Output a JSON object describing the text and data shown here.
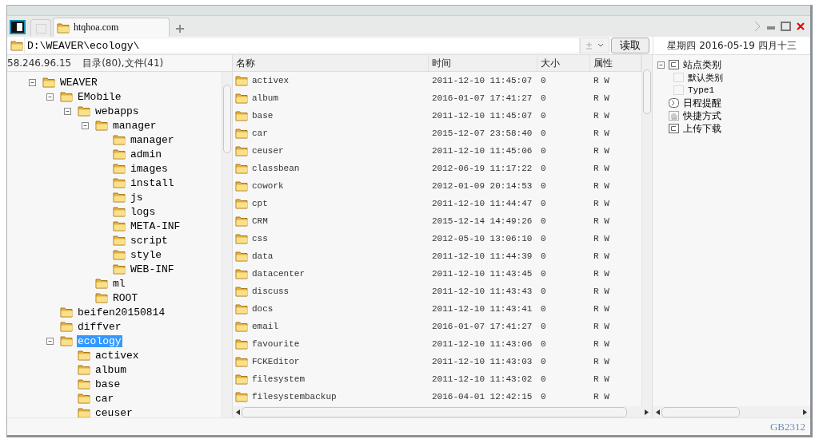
{
  "tabs": [
    {
      "kind": "panel",
      "selected": true
    },
    {
      "kind": "blank",
      "selected": false
    },
    {
      "kind": "site",
      "label": "htqhoa.com",
      "selected": true
    }
  ],
  "address": {
    "value": "D:\\WEAVER\\ecology\\",
    "button": "读取"
  },
  "date": "星期四 2016-05-19 四月十三",
  "server": {
    "ip": "58.246.96.15",
    "counts": "目录(80),文件(41)"
  },
  "folder_tree": [
    {
      "name": "WEAVER",
      "expanded": true,
      "selected": false,
      "children": [
        {
          "name": "EMobile",
          "expanded": true,
          "selected": false,
          "children": [
            {
              "name": "webapps",
              "expanded": true,
              "selected": false,
              "children": [
                {
                  "name": "manager",
                  "expanded": true,
                  "selected": false,
                  "children": [
                    {
                      "name": "manager",
                      "selected": false
                    },
                    {
                      "name": "admin",
                      "selected": false
                    },
                    {
                      "name": "images",
                      "selected": false
                    },
                    {
                      "name": "install",
                      "selected": false
                    },
                    {
                      "name": "js",
                      "selected": false
                    },
                    {
                      "name": "logs",
                      "selected": false
                    },
                    {
                      "name": "META-INF",
                      "selected": false
                    },
                    {
                      "name": "script",
                      "selected": false
                    },
                    {
                      "name": "style",
                      "selected": false
                    },
                    {
                      "name": "WEB-INF",
                      "selected": false
                    }
                  ]
                },
                {
                  "name": "ml",
                  "selected": false
                },
                {
                  "name": "ROOT",
                  "selected": false
                }
              ]
            }
          ]
        },
        {
          "name": "beifen20150814",
          "selected": false
        },
        {
          "name": "diffver",
          "selected": false
        },
        {
          "name": "ecology",
          "expanded": true,
          "selected": true,
          "children": [
            {
              "name": "activex",
              "selected": false
            },
            {
              "name": "album",
              "selected": false
            },
            {
              "name": "base",
              "selected": false
            },
            {
              "name": "car",
              "selected": false
            },
            {
              "name": "ceuser",
              "selected": false
            }
          ]
        }
      ]
    }
  ],
  "table": {
    "columns": [
      "名称",
      "时间",
      "大小",
      "属性"
    ],
    "rows": [
      [
        "activex",
        "2011-12-10 11:45:07",
        "0",
        "R W"
      ],
      [
        "album",
        "2016-01-07 17:41:27",
        "0",
        "R W"
      ],
      [
        "base",
        "2011-12-10 11:45:07",
        "0",
        "R W"
      ],
      [
        "car",
        "2015-12-07 23:58:40",
        "0",
        "R W"
      ],
      [
        "ceuser",
        "2011-12-10 11:45:06",
        "0",
        "R W"
      ],
      [
        "classbean",
        "2012-06-19 11:17:22",
        "0",
        "R W"
      ],
      [
        "cowork",
        "2012-01-09 20:14:53",
        "0",
        "R W"
      ],
      [
        "cpt",
        "2011-12-10 11:44:47",
        "0",
        "R W"
      ],
      [
        "CRM",
        "2015-12-14 14:49:26",
        "0",
        "R W"
      ],
      [
        "css",
        "2012-05-10 13:06:10",
        "0",
        "R W"
      ],
      [
        "data",
        "2011-12-10 11:44:39",
        "0",
        "R W"
      ],
      [
        "datacenter",
        "2011-12-10 11:43:45",
        "0",
        "R W"
      ],
      [
        "discuss",
        "2011-12-10 11:43:43",
        "0",
        "R W"
      ],
      [
        "docs",
        "2011-12-10 11:43:41",
        "0",
        "R W"
      ],
      [
        "email",
        "2016-01-07 17:41:27",
        "0",
        "R W"
      ],
      [
        "favourite",
        "2011-12-10 11:43:06",
        "0",
        "R W"
      ],
      [
        "FCKEditor",
        "2011-12-10 11:43:03",
        "0",
        "R W"
      ],
      [
        "filesystem",
        "2011-12-10 11:43:02",
        "0",
        "R W"
      ],
      [
        "filesystembackup",
        "2016-04-01 12:42:15",
        "0",
        "R W"
      ]
    ]
  },
  "side_tree": [
    {
      "name": "站点类别",
      "kind": "category",
      "expanded": true,
      "children": [
        {
          "name": "默认类别",
          "kind": "item"
        },
        {
          "name": "Type1",
          "kind": "item"
        }
      ]
    },
    {
      "name": "日程提醒",
      "kind": "schedule"
    },
    {
      "name": "快捷方式",
      "kind": "shortcut"
    },
    {
      "name": "上传下载",
      "kind": "transfer"
    }
  ],
  "status_bar": {
    "encoding": "GB2312"
  }
}
